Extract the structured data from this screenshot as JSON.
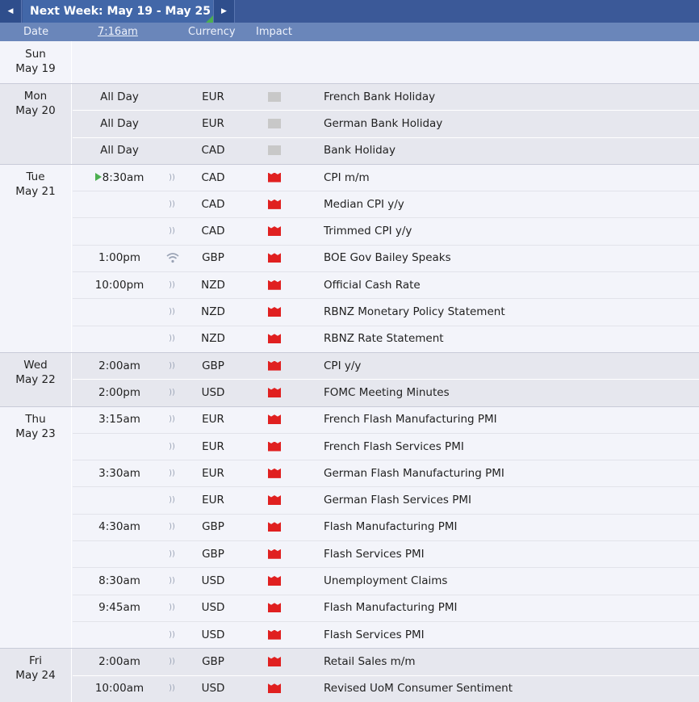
{
  "nav": {
    "week_title": "Next Week: May 19 - May 25",
    "prev_icon": "chevron-left-icon",
    "next_icon": "chevron-right-icon"
  },
  "header": {
    "date": "Date",
    "time": "7:16am",
    "currency": "Currency",
    "impact": "Impact"
  },
  "colors": {
    "high_impact": "#e02020",
    "holiday_impact": "#c8c8c8",
    "topbar": "#3b5998",
    "header": "#6a86ba"
  },
  "days": [
    {
      "day": "Sun",
      "date": "May 19",
      "events": []
    },
    {
      "day": "Mon",
      "date": "May 20",
      "events": [
        {
          "time": "All Day",
          "currency": "EUR",
          "impact": "holiday",
          "name": "French Bank Holiday",
          "sound": false
        },
        {
          "time": "All Day",
          "currency": "EUR",
          "impact": "holiday",
          "name": "German Bank Holiday",
          "sound": false
        },
        {
          "time": "All Day",
          "currency": "CAD",
          "impact": "holiday",
          "name": "Bank Holiday",
          "sound": false
        }
      ]
    },
    {
      "day": "Tue",
      "date": "May 21",
      "events": [
        {
          "time": "8:30am",
          "current": true,
          "currency": "CAD",
          "impact": "high",
          "name": "CPI m/m",
          "sound": true
        },
        {
          "time": "",
          "currency": "CAD",
          "impact": "high",
          "name": "Median CPI y/y",
          "sound": true
        },
        {
          "time": "",
          "currency": "CAD",
          "impact": "high",
          "name": "Trimmed CPI y/y",
          "sound": true
        },
        {
          "time": "1:00pm",
          "currency": "GBP",
          "impact": "high",
          "name": "BOE Gov Bailey Speaks",
          "sound": "live"
        },
        {
          "time": "10:00pm",
          "currency": "NZD",
          "impact": "high",
          "name": "Official Cash Rate",
          "sound": true
        },
        {
          "time": "",
          "currency": "NZD",
          "impact": "high",
          "name": "RBNZ Monetary Policy Statement",
          "sound": true
        },
        {
          "time": "",
          "currency": "NZD",
          "impact": "high",
          "name": "RBNZ Rate Statement",
          "sound": true
        }
      ]
    },
    {
      "day": "Wed",
      "date": "May 22",
      "events": [
        {
          "time": "2:00am",
          "currency": "GBP",
          "impact": "high",
          "name": "CPI y/y",
          "sound": true
        },
        {
          "time": "2:00pm",
          "currency": "USD",
          "impact": "high",
          "name": "FOMC Meeting Minutes",
          "sound": true
        }
      ]
    },
    {
      "day": "Thu",
      "date": "May 23",
      "events": [
        {
          "time": "3:15am",
          "currency": "EUR",
          "impact": "high",
          "name": "French Flash Manufacturing PMI",
          "sound": true
        },
        {
          "time": "",
          "currency": "EUR",
          "impact": "high",
          "name": "French Flash Services PMI",
          "sound": true
        },
        {
          "time": "3:30am",
          "currency": "EUR",
          "impact": "high",
          "name": "German Flash Manufacturing PMI",
          "sound": true
        },
        {
          "time": "",
          "currency": "EUR",
          "impact": "high",
          "name": "German Flash Services PMI",
          "sound": true
        },
        {
          "time": "4:30am",
          "currency": "GBP",
          "impact": "high",
          "name": "Flash Manufacturing PMI",
          "sound": true
        },
        {
          "time": "",
          "currency": "GBP",
          "impact": "high",
          "name": "Flash Services PMI",
          "sound": true
        },
        {
          "time": "8:30am",
          "currency": "USD",
          "impact": "high",
          "name": "Unemployment Claims",
          "sound": true
        },
        {
          "time": "9:45am",
          "currency": "USD",
          "impact": "high",
          "name": "Flash Manufacturing PMI",
          "sound": true
        },
        {
          "time": "",
          "currency": "USD",
          "impact": "high",
          "name": "Flash Services PMI",
          "sound": true
        }
      ]
    },
    {
      "day": "Fri",
      "date": "May 24",
      "events": [
        {
          "time": "2:00am",
          "currency": "GBP",
          "impact": "high",
          "name": "Retail Sales m/m",
          "sound": true
        },
        {
          "time": "10:00am",
          "currency": "USD",
          "impact": "high",
          "name": "Revised UoM Consumer Sentiment",
          "sound": true
        }
      ]
    }
  ]
}
